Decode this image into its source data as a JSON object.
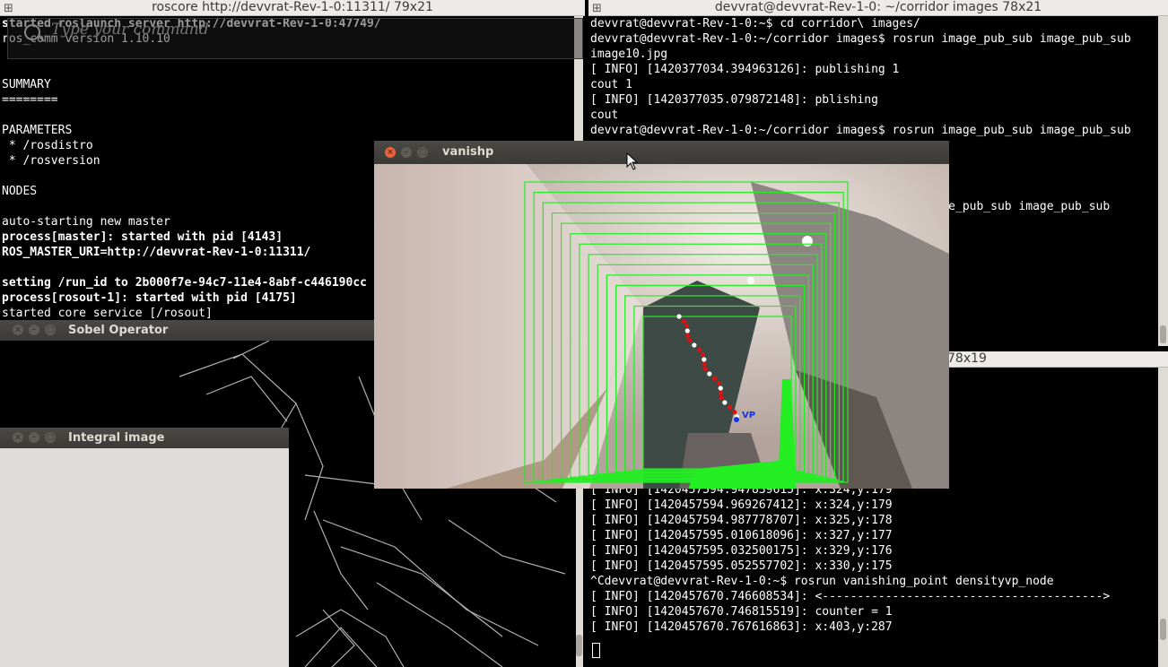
{
  "terminal_left": {
    "title": "roscore http://devvrat-Rev-1-0:11311/ 79x21",
    "lines": [
      "started roslaunch server http://devvrat-Rev-1-0:47749/",
      "ros_comm version 1.10.10",
      "",
      "",
      "SUMMARY",
      "========",
      "",
      "PARAMETERS",
      " * /rosdistro",
      " * /rosversion",
      "",
      "NODES",
      "",
      "auto-starting new master",
      "process[master]: started with pid [4143]",
      "ROS_MASTER_URI=http://devvrat-Rev-1-0:11311/",
      "",
      "setting /run_id to 2b000f7e-94c7-11e4-8abf-c446190cc",
      "process[rosout-1]: started with pid [4175]",
      "started core service [/rosout]"
    ]
  },
  "hud": {
    "placeholder": "Type your command"
  },
  "terminal_right_top": {
    "title": "devvrat@devvrat-Rev-1-0: ~/corridor images 78x21",
    "lines": [
      "devvrat@devvrat-Rev-1-0:~$ cd corridor\\ images/",
      "devvrat@devvrat-Rev-1-0:~/corridor images$ rosrun image_pub_sub image_pub_sub",
      "image10.jpg",
      "[ INFO] [1420377034.394963126]: publishing 1",
      "cout 1",
      "[ INFO] [1420377035.079872148]: pblishing",
      "cout",
      "devvrat@devvrat-Rev-1-0:~/corridor images$ rosrun image_pub_sub image_pub_sub",
      "",
      "",
      "",
      "",
      "                                            ...image_pub_sub image_pub_sub"
    ]
  },
  "terminal_right_bottom": {
    "title_fragment": " 78x19",
    "lines": [
      "",
      "",
      "",
      "",
      "",
      "",
      "",
      "",
      "[ INFO] [1420457594.947839615]: x:324,y:179",
      "[ INFO] [1420457594.969267412]: x:324,y:179",
      "[ INFO] [1420457594.987778707]: x:325,y:178",
      "[ INFO] [1420457595.010618096]: x:327,y:177",
      "[ INFO] [1420457595.032500175]: x:329,y:176",
      "[ INFO] [1420457595.052557702]: x:330,y:175",
      "^Cdevvrat@devvrat-Rev-1-0:~$ rosrun vanishing_point densityvp_node",
      "[ INFO] [1420457670.746608534]: <---------------------------------------->",
      "[ INFO] [1420457670.746815519]: counter = 1",
      "[ INFO] [1420457670.767616863]: x:403,y:287"
    ]
  },
  "windows": {
    "sobel": {
      "title": "Sobel Operator"
    },
    "integral": {
      "title": "Integral image"
    },
    "vanishp": {
      "title": "vanishp",
      "vp_label": "VP"
    }
  },
  "colors": {
    "overlay_green": "#22ee22",
    "track_red": "#dd1111",
    "vp_blue": "#1133ee"
  }
}
